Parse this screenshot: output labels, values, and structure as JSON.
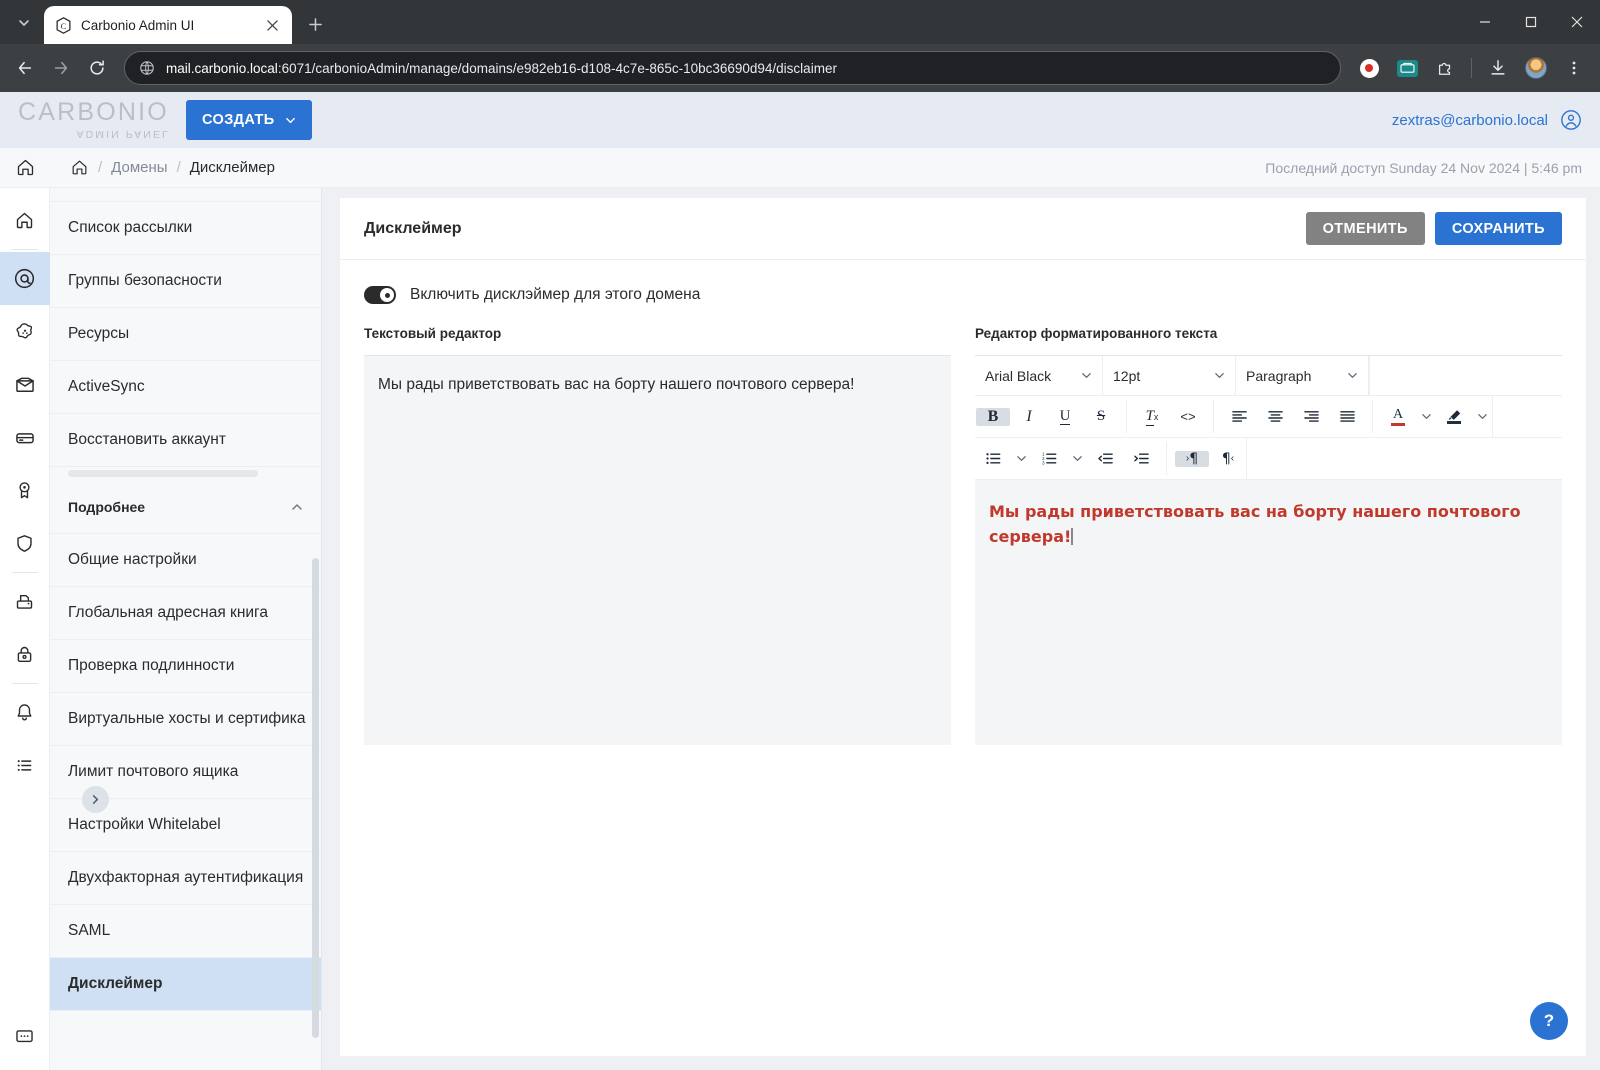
{
  "browser": {
    "tab": {
      "title": "Carbonio Admin UI",
      "favicon": "carbonio-favicon"
    },
    "new_tab_label": "+",
    "url_host": "mail.carbonio.local",
    "url_path": ":6071/carbonioAdmin/manage/domains/e982eb16-d108-4c7e-865c-10bc36690d94/disclaimer",
    "window_controls": {
      "minimize": "minimize-icon",
      "maximize": "maximize-icon",
      "close": "close-icon"
    },
    "toolbar_icons": [
      "back-icon",
      "forward-icon",
      "reload-icon",
      "record-icon",
      "extension-icon",
      "puzzle-icon",
      "download-icon",
      "profile-avatar",
      "browser-menu-icon"
    ]
  },
  "header": {
    "logo_brand": "CARBONIO",
    "logo_sub": "ADMIN PANEL",
    "create_button": "СОЗДАТЬ",
    "user_email": "zextras@carbonio.local"
  },
  "breadcrumb": {
    "home": "home-icon",
    "items": [
      "Домены",
      "Дисклеймер"
    ],
    "separator": "/",
    "last_access": "Последний доступ Sunday 24 Nov 2024 | 5:46 pm"
  },
  "rail": {
    "icons": [
      {
        "name": "home-icon",
        "active": false
      },
      {
        "name": "at-sign-icon",
        "active": true
      },
      {
        "name": "settings-flower-icon",
        "active": false
      },
      {
        "name": "mail-icon",
        "active": false
      },
      {
        "name": "drive-icon",
        "active": false
      },
      {
        "name": "award-icon",
        "active": false
      },
      {
        "name": "shield-icon",
        "active": false
      },
      {
        "name": "printer-icon",
        "active": false
      },
      {
        "name": "lock-icon",
        "active": false
      },
      {
        "name": "bell-icon",
        "active": false
      },
      {
        "name": "list-icon",
        "active": false
      }
    ],
    "bottom_icon": "chat-icon"
  },
  "nav": {
    "items_top": [
      "Список рассылки",
      "Группы безопасности",
      "Ресурсы",
      "ActiveSync",
      "Восстановить аккаунт"
    ],
    "section": {
      "label": "Подробнее",
      "chevron": "chevron-up-icon"
    },
    "items_more": [
      "Общие настройки",
      "Глобальная адресная книга",
      "Проверка подлинности",
      "Виртуальные хосты и сертифика",
      "Лимит почтового ящика",
      "Настройки Whitelabel",
      "Двухфакторная аутентификация",
      "SAML",
      "Дисклеймер"
    ],
    "active_item": "Дисклеймер",
    "collapse_handle": "chevron-right-icon"
  },
  "content": {
    "title": "Дисклеймер",
    "cancel_button": "ОТМЕНИТЬ",
    "save_button": "СОХРАНИТЬ",
    "toggle": {
      "label": "Включить дисклэймер для этого домена",
      "enabled": true
    },
    "plain_editor": {
      "label": "Текстовый редактор",
      "value": "Мы рады приветствовать вас на борту нашего почтового сервера!"
    },
    "rich_editor": {
      "label": "Редактор форматированного текста",
      "font_family": "Arial Black",
      "font_size": "12pt",
      "block_format": "Paragraph",
      "value": "Мы рады приветствовать вас на борту нашего почтового сервера!",
      "text_color": "#c0392b",
      "toolbar_row1": [
        {
          "name": "bold-button",
          "glyph": "B",
          "active": true
        },
        {
          "name": "italic-button",
          "glyph": "I",
          "active": false
        },
        {
          "name": "underline-button",
          "glyph": "U",
          "active": false
        },
        {
          "name": "strikethrough-button",
          "glyph": "S",
          "active": false
        },
        {
          "name": "clear-formatting-button",
          "glyph": "Tx",
          "active": false
        },
        {
          "name": "source-code-button",
          "glyph": "<>",
          "active": false
        },
        {
          "name": "align-left-button",
          "glyph": "align-left",
          "active": false
        },
        {
          "name": "align-center-button",
          "glyph": "align-center",
          "active": false
        },
        {
          "name": "align-right-button",
          "glyph": "align-right",
          "active": false
        },
        {
          "name": "align-justify-button",
          "glyph": "align-justify",
          "active": false
        },
        {
          "name": "text-color-button",
          "glyph": "A",
          "active": false
        },
        {
          "name": "highlight-color-button",
          "glyph": "pen",
          "active": false
        }
      ],
      "toolbar_row2": [
        {
          "name": "bullet-list-button",
          "active": false
        },
        {
          "name": "numbered-list-button",
          "active": false
        },
        {
          "name": "outdent-button",
          "active": false
        },
        {
          "name": "indent-button",
          "active": false
        },
        {
          "name": "ltr-direction-button",
          "active": true
        },
        {
          "name": "rtl-direction-button",
          "active": false
        }
      ]
    },
    "help_button": "?"
  },
  "colors": {
    "accent": "#2b73d2",
    "active_nav": "#cfe0f5",
    "cancel": "#828282",
    "editor_bg": "#f4f5f7",
    "rich_text": "#c0392b"
  }
}
